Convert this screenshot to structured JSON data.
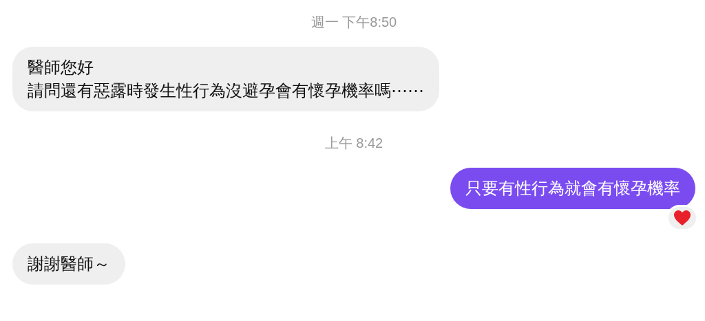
{
  "conversation": [
    {
      "kind": "timestamp",
      "text": "週一 下午8:50"
    },
    {
      "kind": "incoming",
      "lines": [
        "醫師您好",
        "請問還有惡露時發生性行為沒避孕會有懷孕機率嗎⋯⋯"
      ],
      "liked": false
    },
    {
      "kind": "timestamp",
      "text": "上午 8:42"
    },
    {
      "kind": "outgoing",
      "lines": [
        "只要有性行為就會有懷孕機率"
      ],
      "liked": true
    },
    {
      "kind": "incoming",
      "lines": [
        "謝謝醫師～"
      ],
      "liked": false
    }
  ]
}
